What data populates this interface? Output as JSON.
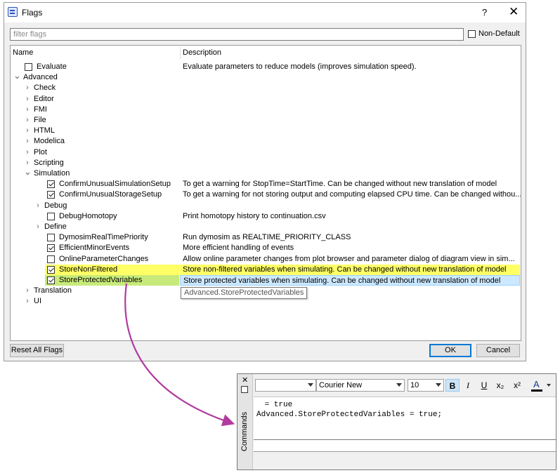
{
  "window": {
    "title": "Flags",
    "help_label": "?",
    "close_label": "✕"
  },
  "filter": {
    "placeholder": "filter flags",
    "value": ""
  },
  "non_default": {
    "label": "Non-Default",
    "checked": false
  },
  "columns": {
    "name": "Name",
    "description": "Description"
  },
  "tree_rows": [
    {
      "name": "Evaluate",
      "level": 1,
      "kind": "flag",
      "checked": false,
      "description": "Evaluate parameters to reduce models (improves simulation speed)."
    },
    {
      "name": "Advanced",
      "level": 0,
      "kind": "group",
      "expanded": true
    },
    {
      "name": "Check",
      "level": 1,
      "kind": "group",
      "expanded": false
    },
    {
      "name": "Editor",
      "level": 1,
      "kind": "group",
      "expanded": false
    },
    {
      "name": "FMI",
      "level": 1,
      "kind": "group",
      "expanded": false
    },
    {
      "name": "File",
      "level": 1,
      "kind": "group",
      "expanded": false
    },
    {
      "name": "HTML",
      "level": 1,
      "kind": "group",
      "expanded": false
    },
    {
      "name": "Modelica",
      "level": 1,
      "kind": "group",
      "expanded": false
    },
    {
      "name": "Plot",
      "level": 1,
      "kind": "group",
      "expanded": false
    },
    {
      "name": "Scripting",
      "level": 1,
      "kind": "group",
      "expanded": false
    },
    {
      "name": "Simulation",
      "level": 1,
      "kind": "group",
      "expanded": true
    },
    {
      "name": "ConfirmUnusualSimulationSetup",
      "level": 3,
      "kind": "flag",
      "checked": true,
      "description": "To get a warning for StopTime=StartTime. Can be changed without new translation of model"
    },
    {
      "name": "ConfirmUnusualStorageSetup",
      "level": 3,
      "kind": "flag",
      "checked": true,
      "description": "To get a warning for not storing output and computing elapsed CPU time. Can be changed withou..."
    },
    {
      "name": "Debug",
      "level": 2,
      "kind": "group",
      "expanded": false
    },
    {
      "name": "DebugHomotopy",
      "level": 3,
      "kind": "flag",
      "checked": false,
      "description": "Print homotopy history to continuation.csv"
    },
    {
      "name": "Define",
      "level": 2,
      "kind": "group",
      "expanded": false
    },
    {
      "name": "DymosimRealTimePriority",
      "level": 3,
      "kind": "flag",
      "checked": false,
      "description": "Run dymosim as REALTIME_PRIORITY_CLASS"
    },
    {
      "name": "EfficientMinorEvents",
      "level": 3,
      "kind": "flag",
      "checked": true,
      "description": "More efficient handling of events"
    },
    {
      "name": "OnlineParameterChanges",
      "level": 3,
      "kind": "flag",
      "checked": false,
      "description": "Allow online parameter changes from plot browser and parameter dialog of diagram view in sim..."
    },
    {
      "name": "StoreNonFiltered",
      "level": 3,
      "kind": "flag",
      "checked": true,
      "highlight": "yellow",
      "description": "Store non-filtered variables when simulating. Can be changed without new translation of model"
    },
    {
      "name": "StoreProtectedVariables",
      "level": 3,
      "kind": "flag",
      "checked": true,
      "highlight": "green",
      "selected": true,
      "description": "Store protected variables when simulating. Can be changed without new translation of model"
    },
    {
      "name": "Translation",
      "level": 1,
      "kind": "group",
      "expanded": false
    },
    {
      "name": "UI",
      "level": 1,
      "kind": "group",
      "expanded": false
    }
  ],
  "tooltip": "Advanced.StoreProtectedVariables",
  "buttons": {
    "reset": "Reset All Flags",
    "ok": "OK",
    "cancel": "Cancel"
  },
  "commands": {
    "panel_label": "Commands",
    "close_label": "✕",
    "toolbar": {
      "style_value": "",
      "font_value": "Courier New",
      "size_value": "10",
      "bold": "B",
      "italic": "I",
      "underline": "U",
      "subscript": "x₂",
      "superscript": "x²",
      "text_color": "A"
    },
    "output_lines": [
      " = true",
      "Advanced.StoreProtectedVariables = true;"
    ],
    "input_value": ""
  },
  "colors": {
    "highlight_yellow": "#ffff66",
    "highlight_green": "#c7ea7a",
    "selection_blue": "#cce8ff",
    "callout_arrow": "#b03a9e"
  }
}
